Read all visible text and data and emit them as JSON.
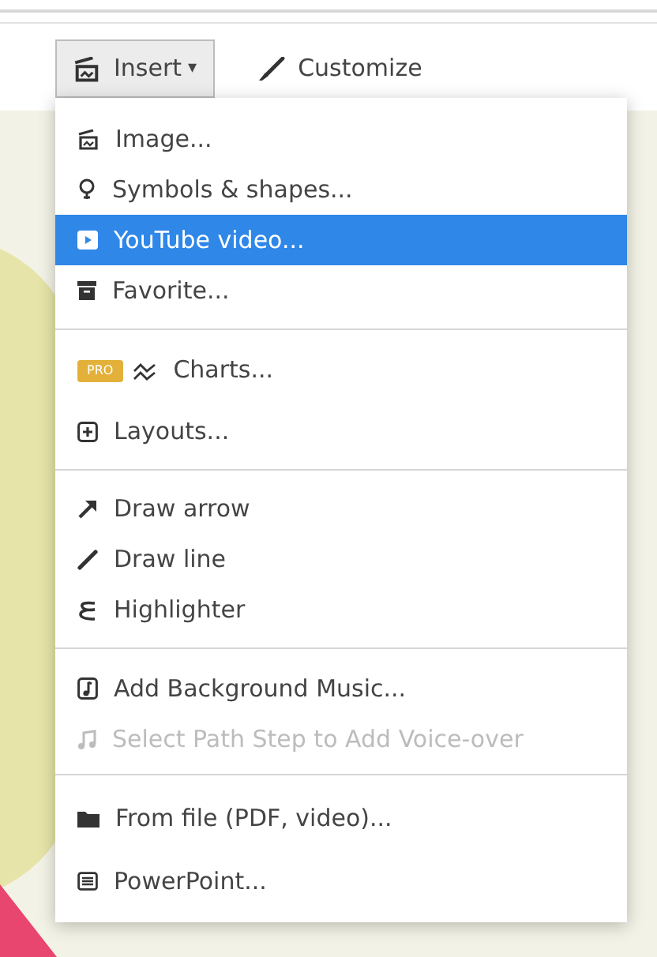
{
  "toolbar": {
    "buttons": [
      {
        "label": "Insert",
        "caret": "▾",
        "selected": true
      },
      {
        "label": "Customize",
        "selected": false
      }
    ]
  },
  "menu": {
    "sections": [
      {
        "items": [
          {
            "label": "Image...",
            "selected": false,
            "disabled": false
          },
          {
            "label": "Symbols & shapes...",
            "selected": false,
            "disabled": false
          },
          {
            "label": "YouTube video...",
            "selected": true,
            "disabled": false
          },
          {
            "label": "Favorite...",
            "selected": false,
            "disabled": false
          }
        ]
      },
      {
        "items": [
          {
            "label": "Charts...",
            "badge": "PRO",
            "selected": false,
            "disabled": false
          },
          {
            "label": "Layouts...",
            "selected": false,
            "disabled": false
          }
        ]
      },
      {
        "items": [
          {
            "label": "Draw arrow",
            "selected": false,
            "disabled": false
          },
          {
            "label": "Draw line",
            "selected": false,
            "disabled": false
          },
          {
            "label": "Highlighter",
            "selected": false,
            "disabled": false
          }
        ]
      },
      {
        "items": [
          {
            "label": "Add Background Music...",
            "selected": false,
            "disabled": false
          },
          {
            "label": "Select Path Step to Add Voice-over",
            "selected": false,
            "disabled": true
          }
        ]
      },
      {
        "items": [
          {
            "label": "From file (PDF, video)...",
            "selected": false,
            "disabled": false
          },
          {
            "label": "PowerPoint...",
            "selected": false,
            "disabled": false
          }
        ]
      }
    ]
  }
}
